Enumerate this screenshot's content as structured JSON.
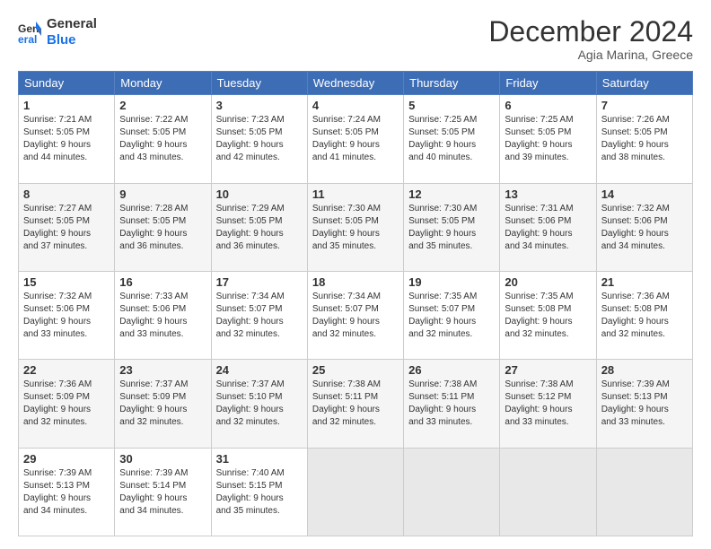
{
  "header": {
    "logo_line1": "General",
    "logo_line2": "Blue",
    "month_title": "December 2024",
    "location": "Agia Marina, Greece"
  },
  "weekdays": [
    "Sunday",
    "Monday",
    "Tuesday",
    "Wednesday",
    "Thursday",
    "Friday",
    "Saturday"
  ],
  "weeks": [
    [
      {
        "day": "1",
        "info": "Sunrise: 7:21 AM\nSunset: 5:05 PM\nDaylight: 9 hours\nand 44 minutes."
      },
      {
        "day": "2",
        "info": "Sunrise: 7:22 AM\nSunset: 5:05 PM\nDaylight: 9 hours\nand 43 minutes."
      },
      {
        "day": "3",
        "info": "Sunrise: 7:23 AM\nSunset: 5:05 PM\nDaylight: 9 hours\nand 42 minutes."
      },
      {
        "day": "4",
        "info": "Sunrise: 7:24 AM\nSunset: 5:05 PM\nDaylight: 9 hours\nand 41 minutes."
      },
      {
        "day": "5",
        "info": "Sunrise: 7:25 AM\nSunset: 5:05 PM\nDaylight: 9 hours\nand 40 minutes."
      },
      {
        "day": "6",
        "info": "Sunrise: 7:25 AM\nSunset: 5:05 PM\nDaylight: 9 hours\nand 39 minutes."
      },
      {
        "day": "7",
        "info": "Sunrise: 7:26 AM\nSunset: 5:05 PM\nDaylight: 9 hours\nand 38 minutes."
      }
    ],
    [
      {
        "day": "8",
        "info": "Sunrise: 7:27 AM\nSunset: 5:05 PM\nDaylight: 9 hours\nand 37 minutes."
      },
      {
        "day": "9",
        "info": "Sunrise: 7:28 AM\nSunset: 5:05 PM\nDaylight: 9 hours\nand 36 minutes."
      },
      {
        "day": "10",
        "info": "Sunrise: 7:29 AM\nSunset: 5:05 PM\nDaylight: 9 hours\nand 36 minutes."
      },
      {
        "day": "11",
        "info": "Sunrise: 7:30 AM\nSunset: 5:05 PM\nDaylight: 9 hours\nand 35 minutes."
      },
      {
        "day": "12",
        "info": "Sunrise: 7:30 AM\nSunset: 5:05 PM\nDaylight: 9 hours\nand 35 minutes."
      },
      {
        "day": "13",
        "info": "Sunrise: 7:31 AM\nSunset: 5:06 PM\nDaylight: 9 hours\nand 34 minutes."
      },
      {
        "day": "14",
        "info": "Sunrise: 7:32 AM\nSunset: 5:06 PM\nDaylight: 9 hours\nand 34 minutes."
      }
    ],
    [
      {
        "day": "15",
        "info": "Sunrise: 7:32 AM\nSunset: 5:06 PM\nDaylight: 9 hours\nand 33 minutes."
      },
      {
        "day": "16",
        "info": "Sunrise: 7:33 AM\nSunset: 5:06 PM\nDaylight: 9 hours\nand 33 minutes."
      },
      {
        "day": "17",
        "info": "Sunrise: 7:34 AM\nSunset: 5:07 PM\nDaylight: 9 hours\nand 32 minutes."
      },
      {
        "day": "18",
        "info": "Sunrise: 7:34 AM\nSunset: 5:07 PM\nDaylight: 9 hours\nand 32 minutes."
      },
      {
        "day": "19",
        "info": "Sunrise: 7:35 AM\nSunset: 5:07 PM\nDaylight: 9 hours\nand 32 minutes."
      },
      {
        "day": "20",
        "info": "Sunrise: 7:35 AM\nSunset: 5:08 PM\nDaylight: 9 hours\nand 32 minutes."
      },
      {
        "day": "21",
        "info": "Sunrise: 7:36 AM\nSunset: 5:08 PM\nDaylight: 9 hours\nand 32 minutes."
      }
    ],
    [
      {
        "day": "22",
        "info": "Sunrise: 7:36 AM\nSunset: 5:09 PM\nDaylight: 9 hours\nand 32 minutes."
      },
      {
        "day": "23",
        "info": "Sunrise: 7:37 AM\nSunset: 5:09 PM\nDaylight: 9 hours\nand 32 minutes."
      },
      {
        "day": "24",
        "info": "Sunrise: 7:37 AM\nSunset: 5:10 PM\nDaylight: 9 hours\nand 32 minutes."
      },
      {
        "day": "25",
        "info": "Sunrise: 7:38 AM\nSunset: 5:11 PM\nDaylight: 9 hours\nand 32 minutes."
      },
      {
        "day": "26",
        "info": "Sunrise: 7:38 AM\nSunset: 5:11 PM\nDaylight: 9 hours\nand 33 minutes."
      },
      {
        "day": "27",
        "info": "Sunrise: 7:38 AM\nSunset: 5:12 PM\nDaylight: 9 hours\nand 33 minutes."
      },
      {
        "day": "28",
        "info": "Sunrise: 7:39 AM\nSunset: 5:13 PM\nDaylight: 9 hours\nand 33 minutes."
      }
    ],
    [
      {
        "day": "29",
        "info": "Sunrise: 7:39 AM\nSunset: 5:13 PM\nDaylight: 9 hours\nand 34 minutes."
      },
      {
        "day": "30",
        "info": "Sunrise: 7:39 AM\nSunset: 5:14 PM\nDaylight: 9 hours\nand 34 minutes."
      },
      {
        "day": "31",
        "info": "Sunrise: 7:40 AM\nSunset: 5:15 PM\nDaylight: 9 hours\nand 35 minutes."
      },
      {
        "day": "",
        "info": ""
      },
      {
        "day": "",
        "info": ""
      },
      {
        "day": "",
        "info": ""
      },
      {
        "day": "",
        "info": ""
      }
    ]
  ]
}
